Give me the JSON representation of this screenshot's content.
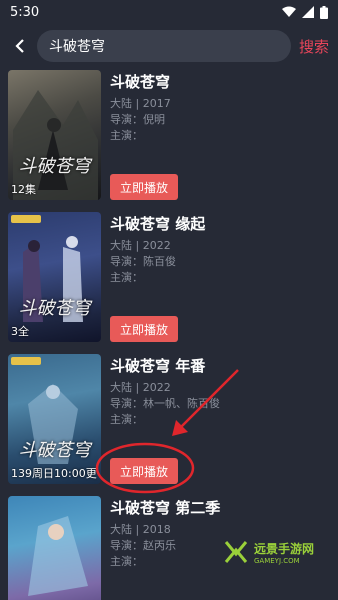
{
  "status_bar": {
    "time": "5:30"
  },
  "header": {
    "query": "斗破苍穹",
    "search_label": "搜索"
  },
  "results": [
    {
      "title": "斗破苍穹",
      "region_year": "大陆 | 2017",
      "director": "导演：倪明",
      "cast": "主演：",
      "badge": "12集",
      "poster_text": "斗破苍穹",
      "play_label": "立即播放"
    },
    {
      "title": "斗破苍穹 缘起",
      "region_year": "大陆 | 2022",
      "director": "导演：陈百俊",
      "cast": "主演：",
      "badge": "3全",
      "poster_text": "斗破苍穹",
      "play_label": "立即播放"
    },
    {
      "title": "斗破苍穹 年番",
      "region_year": "大陆 | 2022",
      "director": "导演：林一帆、陈百俊",
      "cast": "主演：",
      "badge": "139周日10:00更",
      "poster_text": "斗破苍穹",
      "play_label": "立即播放"
    },
    {
      "title": "斗破苍穹 第二季",
      "region_year": "大陆 | 2018",
      "director": "导演：赵丙乐",
      "cast": "主演：",
      "badge": "",
      "poster_text": "",
      "play_label": ""
    }
  ],
  "watermark": {
    "main": "远景手游网",
    "sub": "GAMEYJ.COM"
  },
  "colors": {
    "background": "#262a36",
    "accent": "#e8455a",
    "play_button": "#e85a58",
    "annotation": "#e0262c"
  }
}
